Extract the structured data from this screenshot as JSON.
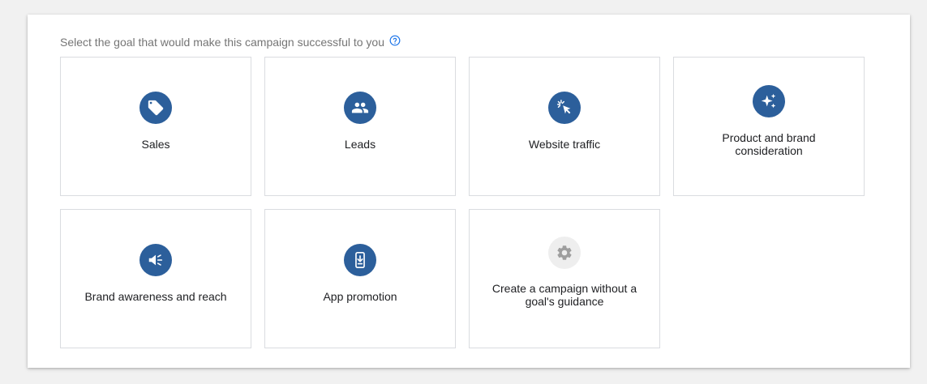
{
  "prompt": {
    "text": "Select the goal that would make this campaign successful to you",
    "help_icon": "help-circle-icon"
  },
  "colors": {
    "icon_bg": "#2c5f9b",
    "icon_bg_disabled": "#eeeeee",
    "card_border": "#dadce0",
    "prompt_text": "#757575",
    "help_icon": "#1a73e8"
  },
  "goals": [
    {
      "label": "Sales",
      "icon": "tag-icon"
    },
    {
      "label": "Leads",
      "icon": "people-icon"
    },
    {
      "label": "Website traffic",
      "icon": "cursor-click-icon"
    },
    {
      "label": "Product and brand consideration",
      "icon": "sparkle-icon"
    },
    {
      "label": "Brand awareness and reach",
      "icon": "megaphone-icon"
    },
    {
      "label": "App promotion",
      "icon": "phone-download-icon"
    },
    {
      "label": "Create a campaign without a goal's guidance",
      "icon": "gear-icon"
    }
  ]
}
